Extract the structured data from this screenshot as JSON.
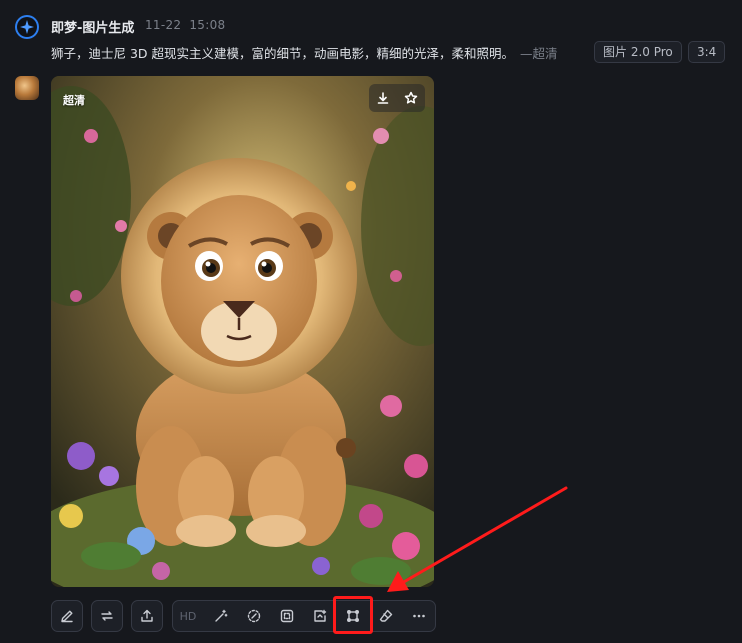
{
  "header": {
    "app_name": "即梦-图片生成",
    "date": "11-22",
    "time": "15:08"
  },
  "prompt": {
    "text": "狮子，迪士尼 3D 超现实主义建模，富的细节，动画电影，精细的光泽，柔和照明。",
    "quality_suffix": "—超清"
  },
  "tags": {
    "model": "图片 2.0 Pro",
    "ratio": "3:4"
  },
  "image": {
    "quality_badge": "超清",
    "actions": [
      "download-icon",
      "star-icon"
    ]
  },
  "toolbar": {
    "standalone": [
      "edit-icon",
      "regenerate-icon",
      "share-upload-icon"
    ],
    "group": [
      {
        "type": "text",
        "label": "HD"
      },
      {
        "type": "icon",
        "name": "magic-wand-icon"
      },
      {
        "type": "icon",
        "name": "partial-redraw-icon"
      },
      {
        "type": "icon",
        "name": "expand-frame-icon"
      },
      {
        "type": "icon",
        "name": "image-upscale-icon"
      },
      {
        "type": "icon",
        "name": "crop-resize-icon"
      },
      {
        "type": "icon",
        "name": "eraser-icon"
      },
      {
        "type": "icon",
        "name": "more-icon"
      }
    ]
  },
  "annotation": {
    "highlight_color": "#ff1b1b",
    "highlighted_tool": "crop-resize-icon"
  },
  "colors": {
    "background": "#16181d",
    "accent": "#2d7ff0",
    "annotation": "#ff1b1b"
  }
}
